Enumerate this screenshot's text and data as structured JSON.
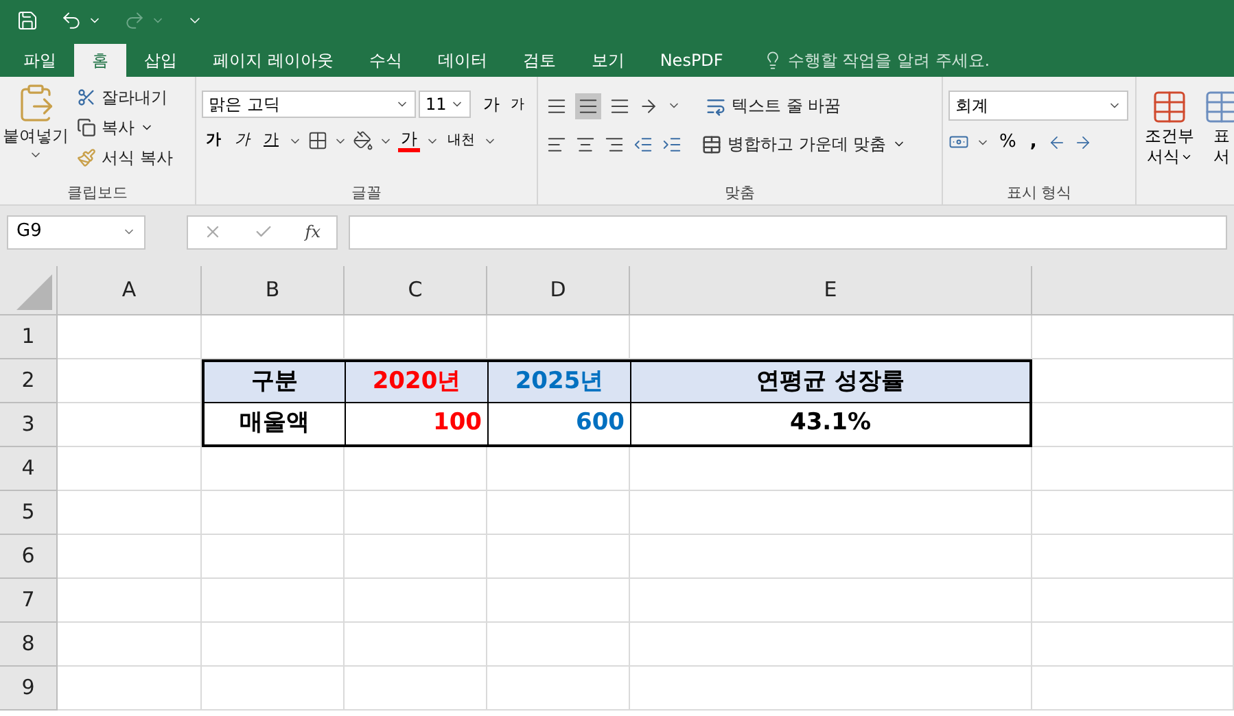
{
  "tabs": [
    {
      "label": "파일",
      "selected": false
    },
    {
      "label": "홈",
      "selected": true
    },
    {
      "label": "삽입",
      "selected": false
    },
    {
      "label": "페이지 레이아웃",
      "selected": false
    },
    {
      "label": "수식",
      "selected": false
    },
    {
      "label": "데이터",
      "selected": false
    },
    {
      "label": "검토",
      "selected": false
    },
    {
      "label": "보기",
      "selected": false
    },
    {
      "label": "NesPDF",
      "selected": false
    }
  ],
  "tell_me": "수행할 작업을 알려 주세요.",
  "ribbon": {
    "clipboard": {
      "paste": "붙여넣기",
      "cut": "잘라내기",
      "copy": "복사",
      "format_painter": "서식 복사",
      "label": "클립보드"
    },
    "font": {
      "font_name": "맑은 고딕",
      "font_size": "11",
      "grow": "가",
      "shrink": "가",
      "bold": "가",
      "italic": "가",
      "underline": "가",
      "font_color": "가",
      "phonetic": "내천",
      "label": "글꼴"
    },
    "alignment": {
      "wrap_text": "텍스트 줄 바꿈",
      "merge": "병합하고 가운데 맞춤",
      "label": "맞춤"
    },
    "number": {
      "format": "회계",
      "percent": "%",
      "comma": ",",
      "label": "표시 형식"
    },
    "styles": {
      "conditional_line1": "조건부",
      "conditional_line2": "서식",
      "table_line1": "표",
      "table_line2": "서"
    }
  },
  "formula_bar": {
    "name_box": "G9",
    "fx": "fx"
  },
  "sheet": {
    "columns": [
      "A",
      "B",
      "C",
      "D",
      "E"
    ],
    "rows": [
      "1",
      "2",
      "3",
      "4",
      "5",
      "6",
      "7",
      "8",
      "9"
    ],
    "table": {
      "header": [
        {
          "text": "구분",
          "color": "#000000"
        },
        {
          "text": "2020년",
          "color": "#ff0000"
        },
        {
          "text": "2025년",
          "color": "#0070c0"
        },
        {
          "text": "연평균 성장률",
          "color": "#000000"
        }
      ],
      "body": [
        {
          "text": "매울액",
          "color": "#000000",
          "kind": "text"
        },
        {
          "text": "100",
          "color": "#ff0000",
          "kind": "number"
        },
        {
          "text": "600",
          "color": "#0070c0",
          "kind": "number"
        },
        {
          "text": "43.1%",
          "color": "#000000",
          "kind": "text"
        }
      ]
    }
  }
}
